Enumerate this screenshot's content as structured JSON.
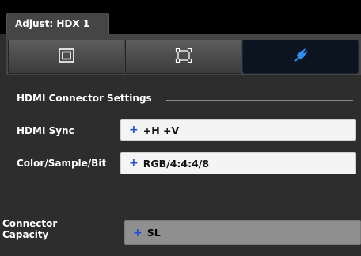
{
  "window": {
    "tab_title": "Adjust: HDX 1"
  },
  "subtabs": [
    {
      "name": "frame-icon",
      "active": false
    },
    {
      "name": "corners-icon",
      "active": false
    },
    {
      "name": "connector-plug-icon",
      "active": true
    }
  ],
  "section": {
    "title": "HDMI Connector Settings"
  },
  "rows": {
    "hdmi_sync": {
      "label": "HDMI Sync",
      "value": "+H +V"
    },
    "color_sample": {
      "label": "Color/Sample/Bit",
      "value": "RGB/4:4:4/8"
    },
    "capacity": {
      "label_line1": "Connector",
      "label_line2": "Capacity",
      "value": "SL"
    }
  },
  "plus_glyph": "+",
  "colors": {
    "accent": "#1f4fd0",
    "plug_icon": "#2e8df0",
    "active_tab_bg": "#0c1420"
  }
}
